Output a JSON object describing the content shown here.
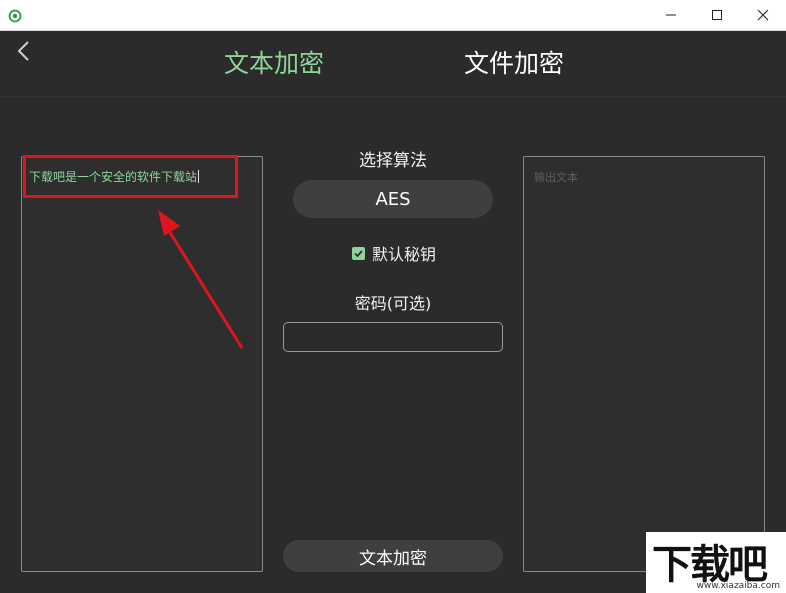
{
  "window": {
    "icon": "app-eye-icon",
    "controls": [
      "minimize-icon",
      "maximize-icon",
      "close-icon"
    ]
  },
  "header": {
    "back_icon": "chevron-left-icon",
    "tabs": [
      {
        "label": "文本加密",
        "active": true
      },
      {
        "label": "文件加密",
        "active": false
      }
    ]
  },
  "input": {
    "value": "下载吧是一个安全的软件下载站"
  },
  "algorithm": {
    "label": "选择算法",
    "selected": "AES"
  },
  "default_key": {
    "label": "默认秘钥",
    "checked": true
  },
  "password": {
    "label": "密码(可选)",
    "value": ""
  },
  "action": {
    "label": "文本加密"
  },
  "output": {
    "placeholder": "输出文本"
  },
  "watermark": {
    "logo": "下载吧",
    "url": "www.xiazaiba.com"
  },
  "colors": {
    "accent": "#8fd49a",
    "background": "#2b2b2b",
    "annotation": "#e0141e"
  }
}
